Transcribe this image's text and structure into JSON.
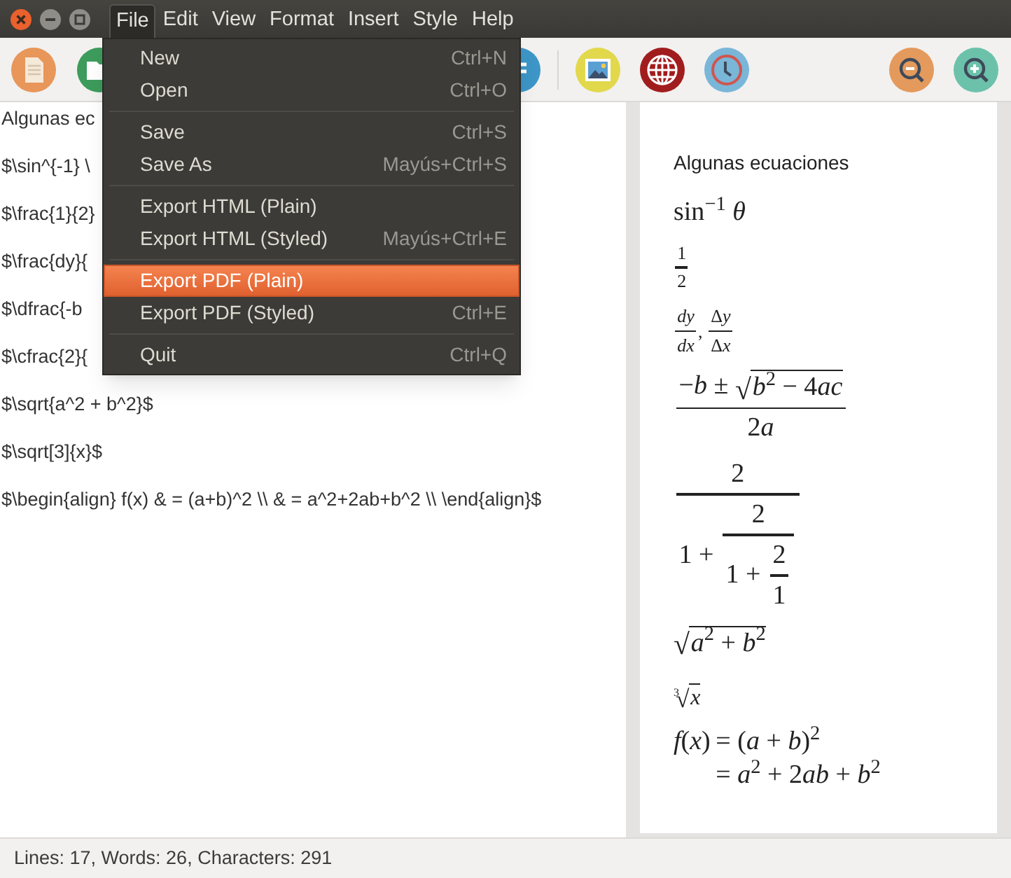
{
  "menubar": [
    {
      "label": "File",
      "selected": true
    },
    {
      "label": "Edit",
      "selected": false
    },
    {
      "label": "View",
      "selected": false
    },
    {
      "label": "Format",
      "selected": false
    },
    {
      "label": "Insert",
      "selected": false
    },
    {
      "label": "Style",
      "selected": false
    },
    {
      "label": "Help",
      "selected": false
    }
  ],
  "file_menu": [
    [
      {
        "label": "New",
        "shortcut": "Ctrl+N",
        "selected": false
      },
      {
        "label": "Open",
        "shortcut": "Ctrl+O",
        "selected": false
      }
    ],
    [
      {
        "label": "Save",
        "shortcut": "Ctrl+S",
        "selected": false
      },
      {
        "label": "Save As",
        "shortcut": "Mayús+Ctrl+S",
        "selected": false
      }
    ],
    [
      {
        "label": "Export HTML (Plain)",
        "selected": false
      },
      {
        "label": "Export HTML (Styled)",
        "shortcut": "Mayús+Ctrl+E",
        "selected": false
      }
    ],
    [
      {
        "label": "Export PDF (Plain)",
        "selected": true
      },
      {
        "label": "Export PDF (Styled)",
        "shortcut": "Ctrl+E",
        "selected": false
      }
    ],
    [
      {
        "label": "Quit",
        "shortcut": "Ctrl+Q",
        "selected": false
      }
    ]
  ],
  "editor_lines": [
    "Algunas ec",
    "$\\sin^{-1} \\",
    "$\\frac{1}{2}",
    "$\\frac{dy}{",
    "$\\dfrac{-b",
    "$\\cfrac{2}{",
    "$\\sqrt{a^2 + b^2}$",
    "$\\sqrt[3]{x}$",
    "$\\begin{align} f(x) & = (a+b)^2 \\\\ & = a^2+2ab+b^2 \\\\ \\end{align}$"
  ],
  "preview": [
    {
      "kind": "text",
      "text": "Algunas ecuaciones"
    },
    {
      "kind": "math",
      "math": "sin$^{−1}$ *θ*"
    },
    {
      "kind": "script_math",
      "math": {
        "frac": {
          "num": "1",
          "den": "2"
        }
      }
    },
    {
      "kind": "script_math",
      "math": {
        "seq": [
          {
            "frac": {
              "num": "*dy*",
              "den": "*dx*"
            }
          },
          ", ",
          {
            "frac": {
              "num": {
                "seq": [
                  "Δ",
                  "*y*"
                ]
              },
              "den": {
                "seq": [
                  "Δ",
                  "*x*"
                ]
              }
            }
          }
        ]
      }
    },
    {
      "kind": "math",
      "math": {
        "frac": {
          "num": {
            "seq": [
              "−*b* ± ",
              {
                "sqrt": {
                  "radical": "√",
                  "body": {
                    "seq": [
                      "*b*$^{2}$ − 4",
                      "*ac*"
                    ]
                  }
                }
              }
            ]
          },
          "den": {
            "seq": [
              "2",
              "*a*"
            ]
          }
        }
      }
    },
    {
      "kind": "math",
      "math": {
        "frac": {
          "num": "2",
          "den": {
            "seq": [
              "1 + ",
              {
                "frac": {
                  "num": "2",
                  "den": {
                    "seq": [
                      "1 + ",
                      {
                        "frac": {
                          "num": "2",
                          "den": "1"
                        }
                      }
                    ]
                  }
                }
              }
            ]
          }
        }
      }
    },
    {
      "kind": "math",
      "math": {
        "sqrt": {
          "radical": "√",
          "body": "*a*$^{2}$ + *b*$^{2}$"
        }
      }
    },
    {
      "kind": "small_math",
      "math": {
        "sqrt": {
          "radical": "√",
          "index": "3",
          "body": "*x*"
        }
      }
    },
    {
      "kind": "math",
      "math": {
        "align": [
          [
            "*f*(*x*)",
            "= (*a* + *b*)$^{2}$"
          ],
          [
            {
              "seq": [
                "= *a*$^{2}$ + 2",
                "*ab* + *b*$^{2}$"
              ]
            }
          ]
        ]
      }
    }
  ],
  "status_bar": "Lines: 17, Words: 26, Characters: 291"
}
